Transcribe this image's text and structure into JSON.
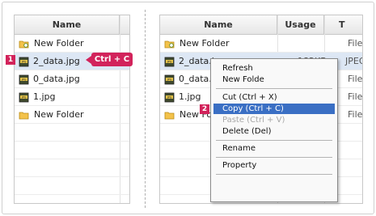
{
  "left_panel": {
    "header": {
      "name": "Name"
    },
    "rows": [
      {
        "name": "New Folder",
        "icon": "folder-link-icon"
      },
      {
        "name": "2_data.jpg",
        "icon": "jpeg-file-icon"
      },
      {
        "name": "0_data.jpg",
        "icon": "jpeg-file-icon"
      },
      {
        "name": "1.jpg",
        "icon": "jpeg-file-icon"
      },
      {
        "name": "New Folder",
        "icon": "folder-icon"
      }
    ]
  },
  "right_panel": {
    "header": {
      "name": "Name",
      "usage": "Usage",
      "type": "T"
    },
    "rows": [
      {
        "name": "New Folder",
        "usage": "",
        "type": "File",
        "icon": "folder-link-icon"
      },
      {
        "name": "2_data.jpg",
        "usage": "182KB",
        "type": "JPEG",
        "icon": "jpeg-file-icon"
      },
      {
        "name": "0_data.jpg",
        "usage": "",
        "type": "File",
        "icon": "jpeg-file-icon"
      },
      {
        "name": "1.jpg",
        "usage": "",
        "type": "File",
        "icon": "jpeg-file-icon"
      },
      {
        "name": "New Folder",
        "usage": "",
        "type": "File",
        "icon": "folder-icon"
      }
    ]
  },
  "context_menu": {
    "refresh": "Refresh",
    "new_folder": "New Folde",
    "cut": "Cut (Ctrl + X)",
    "copy": "Copy (Ctrl + C)",
    "paste": "Paste (Ctrl + V)",
    "delete": "Delete (Del)",
    "rename": "Rename",
    "property": "Property"
  },
  "annotations": {
    "step1": "1",
    "step2": "2",
    "shortcut": "Ctrl + C",
    "accent_color": "#d2235b",
    "highlight_color": "#3a6fc4"
  }
}
